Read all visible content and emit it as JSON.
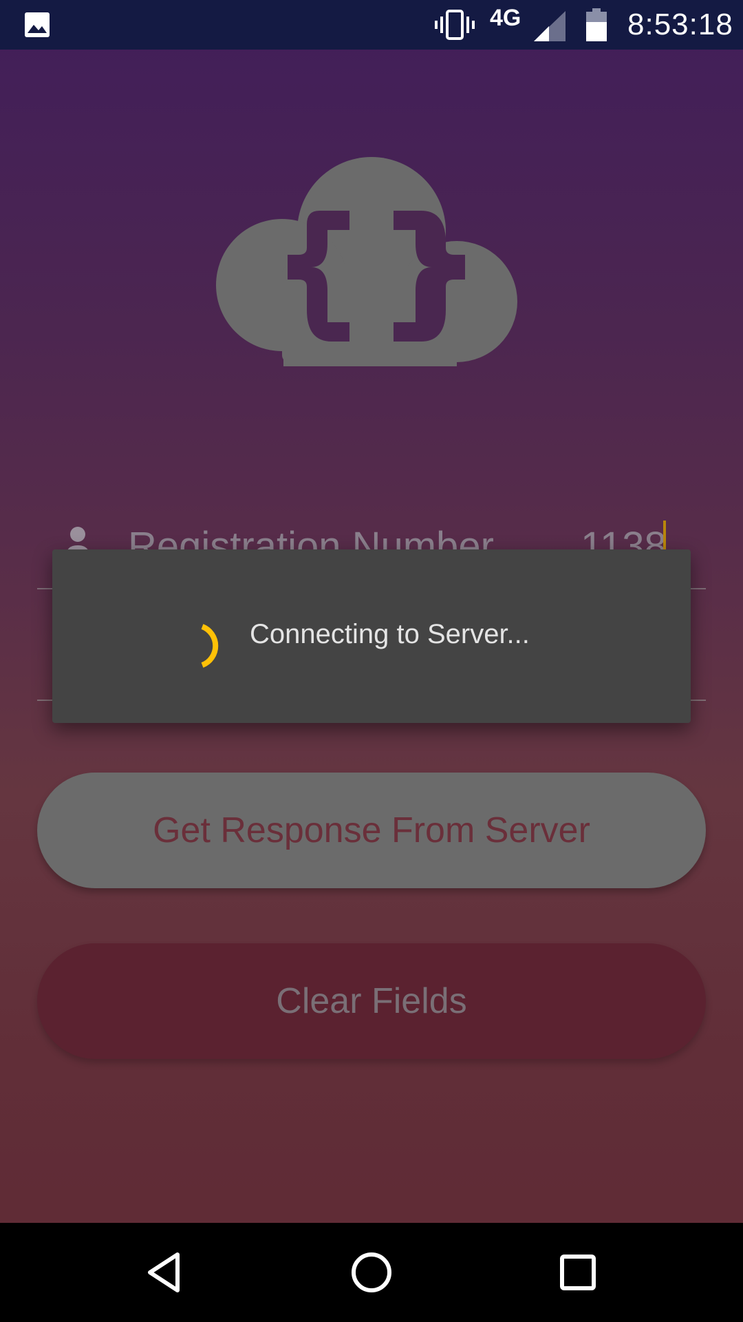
{
  "status_bar": {
    "network_type": "4G",
    "time": "8:53:18",
    "icons": [
      "gallery-icon",
      "vibrate-icon",
      "signal-icon",
      "battery-icon"
    ]
  },
  "logo": {
    "icon": "cloud-braces-icon"
  },
  "form": {
    "registration": {
      "label": "Registration Number",
      "value": "1138",
      "icon": "person-icon"
    }
  },
  "buttons": {
    "get_response": "Get Response From Server",
    "clear_fields": "Clear Fields"
  },
  "dialog": {
    "message": "Connecting to Server...",
    "spinner_color": "#ffc107"
  },
  "nav_bar": {
    "icons": [
      "back-icon",
      "home-icon",
      "recents-icon"
    ]
  },
  "colors": {
    "status_bar": "#141a43",
    "dialog_bg": "#444444",
    "accent": "#ffc107"
  }
}
